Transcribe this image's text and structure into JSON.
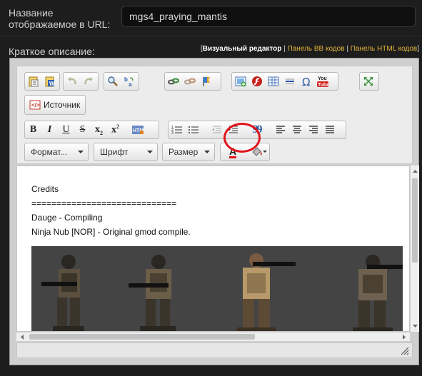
{
  "url_field": {
    "label": "Название отображаемое в URL:",
    "value": "mgs4_praying_mantis"
  },
  "description": {
    "label": "Краткое описание:"
  },
  "editor_switch": {
    "open_bracket": "[",
    "visual": "Визуальный редактор",
    "sep1": "|",
    "bb": "Панель BB кодов",
    "sep2": "|",
    "html": "Панель HTML кодов",
    "close_bracket": "]"
  },
  "toolbar": {
    "source_label": "Источник",
    "bold": "B",
    "italic": "I",
    "underline": "U",
    "strike": "S",
    "subscript": "x",
    "subscript_mark": "2",
    "superscript": "x",
    "superscript_mark": "2",
    "quote": "99",
    "format_label": "Формат...",
    "font_label": "Шрифт",
    "size_label": "Размер",
    "text_color_letter": "A"
  },
  "content": {
    "lines": [
      "Credits",
      "=============================",
      "Dauge - Compiling",
      "Ninja Nub [NOR] - Original gmod compile."
    ]
  },
  "colors": {
    "page_bg": "#1d1d1d",
    "link": "#e2b53c",
    "highlight": "#e0141a"
  }
}
